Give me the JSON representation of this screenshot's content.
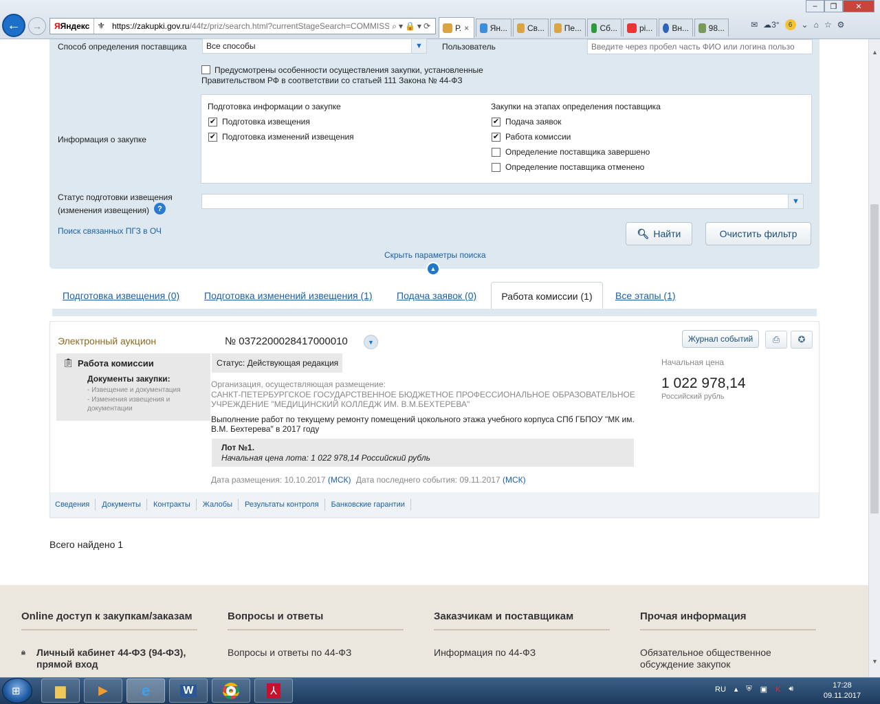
{
  "browser": {
    "search_brand": "Яндекс",
    "url_host": "https://zakupki.gov.ru",
    "url_path": "/44fz/priz/search.html?currentStageSearch=COMMISSI",
    "tabs": [
      {
        "label": "Р.",
        "icon": "emblem-icon",
        "close": "×"
      },
      {
        "label": "Ян...",
        "icon": "ie-icon"
      },
      {
        "label": "Св...",
        "icon": "emblem-icon"
      },
      {
        "label": "Пе...",
        "icon": "emblem-icon"
      },
      {
        "label": "Сб...",
        "icon": "sber-icon"
      },
      {
        "label": "pi...",
        "icon": "yandex-icon"
      },
      {
        "label": "Вн...",
        "icon": "globe-icon"
      },
      {
        "label": "98...",
        "icon": "image-icon"
      }
    ],
    "weather": "3°",
    "mail_count": "6"
  },
  "search": {
    "method_label": "Способ определения поставщика",
    "method_value": "Все способы",
    "user_label": "Пользователь",
    "user_placeholder": "Введите через пробел часть ФИО или логина пользо",
    "feature_line1": "Предусмотрены особенности осуществления закупки, установленные",
    "feature_line2": "Правительством РФ в соответствии со статьей 111 Закона № 44-ФЗ",
    "info_label": "Информация о закупке",
    "prep_title": "Подготовка информации о закупке",
    "prep_items": [
      {
        "label": "Подготовка извещения",
        "check": "✔"
      },
      {
        "label": "Подготовка изменений извещения",
        "check": "✔"
      }
    ],
    "stage_title": "Закупки на этапах определения поставщика",
    "stage_items": [
      {
        "label": "Подача заявок",
        "check": "✔"
      },
      {
        "label": "Работа комиссии",
        "check": "✔"
      },
      {
        "label": "Определение поставщика завершено",
        "check": ""
      },
      {
        "label": "Определение поставщика отменено",
        "check": ""
      }
    ],
    "status_label_line1": "Статус подготовки извещения",
    "status_label_line2": "(изменения извещения)",
    "help": "?",
    "related_link": "Поиск связанных ПГЗ в ОЧ",
    "find_button": "Найти",
    "clear_button": "Очистить фильтр",
    "hide_params": "Скрыть параметры поиска"
  },
  "result_tabs": [
    "Подготовка извещения (0)",
    "Подготовка изменений извещения (1)",
    "Подача заявок (0)",
    "Работа комиссии (1)",
    "Все этапы (1)"
  ],
  "result": {
    "type": "Электронный аукцион",
    "number": "№ 0372200028417000010",
    "journal_button": "Журнал событий",
    "stage": "Работа комиссии",
    "docs_title": "Документы закупки:",
    "docs_items": [
      "- Извещение и документация",
      "- Изменения извещения и",
      "документации"
    ],
    "status": "Статус: Действующая редакция",
    "org_label": "Организация, осуществляющая размещение:",
    "org_line1": "САНКТ-ПЕТЕРБУРГСКОЕ ГОСУДАРСТВЕННОЕ БЮДЖЕТНОЕ ПРОФЕССИОНАЛЬНОЕ ОБРАЗОВАТЕЛЬНОЕ",
    "org_line2": "УЧРЕЖДЕНИЕ \"МЕДИЦИНСКИЙ КОЛЛЕДЖ ИМ. В.М.БЕХТЕРЕВА\"",
    "desc_line1": "Выполнение работ по текущему ремонту помещений цокольного этажа учебного корпуса СПб ГБПОУ \"МК им.",
    "desc_line2": "В.М. Бехтерева\" в 2017 году",
    "lot_title": "Лот №1.",
    "lot_price": "Начальная цена лота: 1 022 978,14 Российский рубль",
    "placed_label": "Дата размещения: 10.10.2017",
    "msk1": "(МСК)",
    "event_label": "Дата последнего события: 09.11.2017",
    "msk2": "(МСК)",
    "price_label": "Начальная цена",
    "price_value": "1 022 978,14",
    "currency": "Российский рубль",
    "bottom_links": [
      "Сведения",
      "Документы",
      "Контракты",
      "Жалобы",
      "Результаты контроля",
      "Банковские гарантии"
    ]
  },
  "total": "Всего найдено 1",
  "footer": {
    "col1_title": "Online доступ к закупкам/заказам",
    "col1_item": "Личный кабинет 44-ФЗ (94-ФЗ), прямой вход",
    "col2_title": "Вопросы и ответы",
    "col2_item": "Вопросы и ответы по 44-ФЗ",
    "col3_title": "Заказчикам и поставщикам",
    "col3_item": "Информация по 44-ФЗ",
    "col4_title": "Прочая информация",
    "col4_item": "Обязательное общественное обсуждение закупок"
  },
  "taskbar": {
    "lang": "RU",
    "time": "17:28",
    "date": "09.11.2017"
  }
}
